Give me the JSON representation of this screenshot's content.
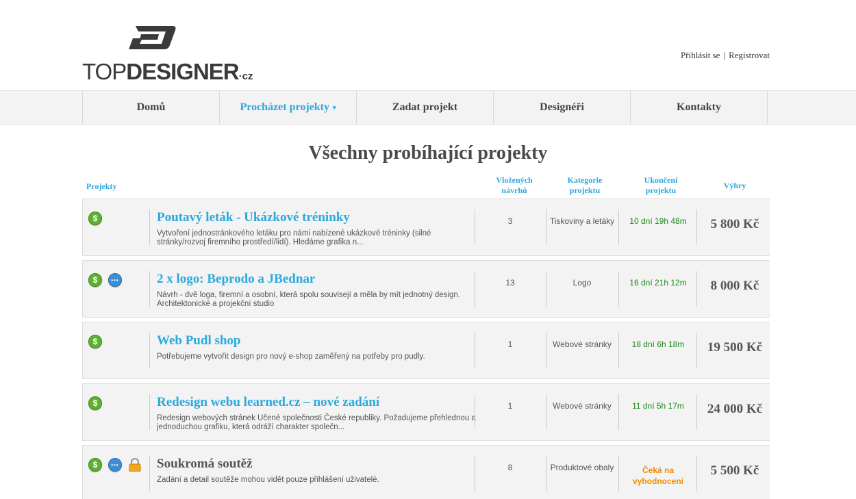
{
  "logo": {
    "text_top": "TOP",
    "text_designer": "DESIGNER",
    "text_cz": "·cz"
  },
  "auth": {
    "login": "Přihlásit se",
    "separator": "|",
    "register": "Registrovat"
  },
  "nav": [
    {
      "label": "Domů"
    },
    {
      "label": "Procházet projekty",
      "caret": "▾"
    },
    {
      "label": "Zadat projekt"
    },
    {
      "label": "Designéři"
    },
    {
      "label": "Kontakty"
    }
  ],
  "page_title": "Všechny probíhající projekty",
  "table_headers": {
    "projects": "Projekty",
    "count": "Vložených návrhů",
    "category": "Kategorie projektu",
    "end": "Ukončení projektu",
    "prize": "Výhry"
  },
  "projects": [
    {
      "title": "Poutavý leták - Ukázkové tréninky",
      "description": "Vytvoření jednostránkového letáku pro námi nabízené ukázkové tréninky (silné stránky/rozvoj firemního prostředí/lidí). Hledáme grafika n...",
      "count": "3",
      "category": "Tiskoviny a letáky",
      "end": "10 dní 19h 48m",
      "prize": "5 800 Kč"
    },
    {
      "title": "2 x logo: Beprodo a JBednar",
      "description": "Návrh - dvě loga, firemní a osobní, která spolu souvisejí a měla by mít jednotný design. Architektonické a projekční studio",
      "count": "13",
      "category": "Logo",
      "end": "16 dní 21h 12m",
      "prize": "8 000 Kč"
    },
    {
      "title": "Web Pudl shop",
      "description": "Potřebujeme vytvořit design pro nový e-shop zaměřený na potřeby pro pudly.",
      "count": "1",
      "category": "Webové stránky",
      "end": "18 dní 6h 18m",
      "prize": "19 500 Kč"
    },
    {
      "title": "Redesign webu learned.cz – nové zadání",
      "description": "Redesign webových stránek Učené společnosti České republiky. Požadujeme přehlednou a jednoduchou grafiku, která odráží charakter společn...",
      "count": "1",
      "category": "Webové stránky",
      "end": "11 dní 5h 17m",
      "prize": "24 000 Kč"
    },
    {
      "title": "Soukromá soutěž",
      "description": "Zadání a detail soutěže mohou vidět pouze přihlášení uživatelé.",
      "count": "8",
      "category": "Produktové obaly",
      "end": "Čeká na vyhodnocení",
      "prize": "5 500 Kč"
    }
  ],
  "icon_glyphs": {
    "dollar": "$",
    "chat": "•••"
  },
  "colors": {
    "accent": "#29a9dc",
    "time_green": "#1a8a1a",
    "pending_orange": "#f08c00"
  }
}
